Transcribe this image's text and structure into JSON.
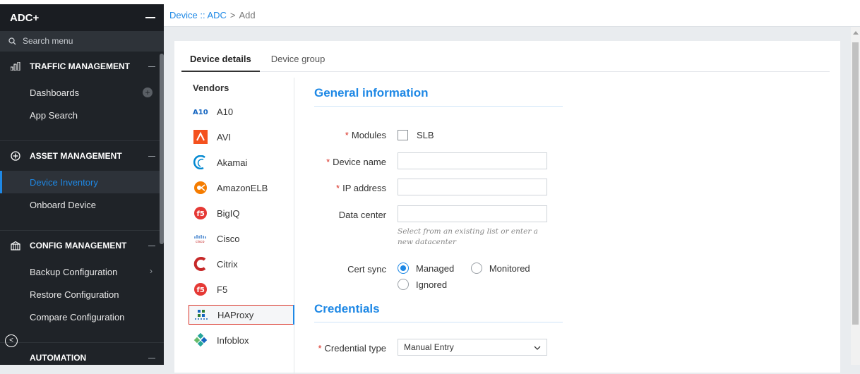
{
  "sidebar": {
    "title": "ADC+",
    "search_placeholder": "Search menu",
    "sections": {
      "traffic": {
        "label": "TRAFFIC MANAGEMENT",
        "items": [
          "Dashboards",
          "App Search"
        ]
      },
      "asset": {
        "label": "ASSET MANAGEMENT",
        "items": [
          "Device Inventory",
          "Onboard Device"
        ]
      },
      "config": {
        "label": "CONFIG MANAGEMENT",
        "items": [
          "Backup Configuration",
          "Restore Configuration",
          "Compare Configuration"
        ]
      },
      "automation": {
        "label": "AUTOMATION"
      }
    },
    "active_item": "Device Inventory"
  },
  "breadcrumb": {
    "part1": "Device :: ADC",
    "separator": ">",
    "current": "Add"
  },
  "tabs": [
    "Device details",
    "Device group"
  ],
  "vendors": {
    "title": "Vendors",
    "items": [
      "A10",
      "AVI",
      "Akamai",
      "AmazonELB",
      "BigIQ",
      "Cisco",
      "Citrix",
      "F5",
      "HAProxy",
      "Infoblox"
    ],
    "selected": "HAProxy"
  },
  "general": {
    "title": "General information",
    "modules_label": "Modules",
    "modules_option": "SLB",
    "device_name_label": "Device name",
    "device_name_value": "",
    "ip_label": "IP address",
    "ip_value": "",
    "datacenter_label": "Data center",
    "datacenter_value": "",
    "datacenter_help": "Select from an existing list or enter a new datacenter",
    "cert_label": "Cert sync",
    "cert_options": [
      "Managed",
      "Monitored",
      "Ignored"
    ],
    "cert_selected": "Managed"
  },
  "credentials": {
    "title": "Credentials",
    "type_label": "Credential type",
    "type_value": "Manual Entry"
  },
  "colors": {
    "accent": "#1e88e5",
    "sidebar_bg": "#1f2328",
    "required": "#d93025"
  }
}
